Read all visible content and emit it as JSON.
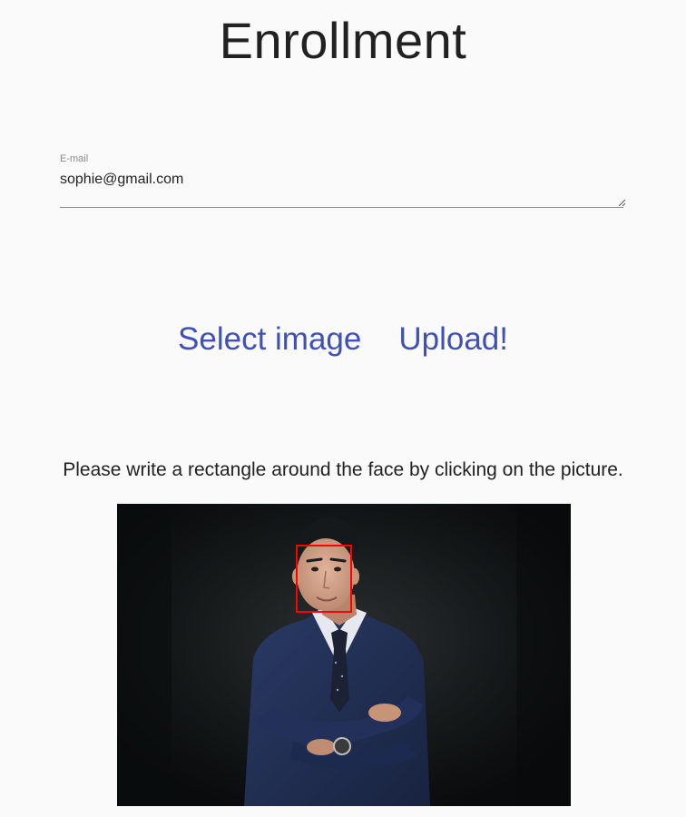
{
  "page": {
    "title": "Enrollment"
  },
  "email_field": {
    "label": "E-mail",
    "value": "sophie@gmail.com"
  },
  "actions": {
    "select_label": "Select image",
    "upload_label": "Upload!"
  },
  "instructions": "Please write a rectangle around the face by clicking on the picture.",
  "picture": {
    "subject": "portrait-photo",
    "selection_color": "#ff0000"
  },
  "colors": {
    "accent": "#3f51b5",
    "background": "#fafafa"
  }
}
